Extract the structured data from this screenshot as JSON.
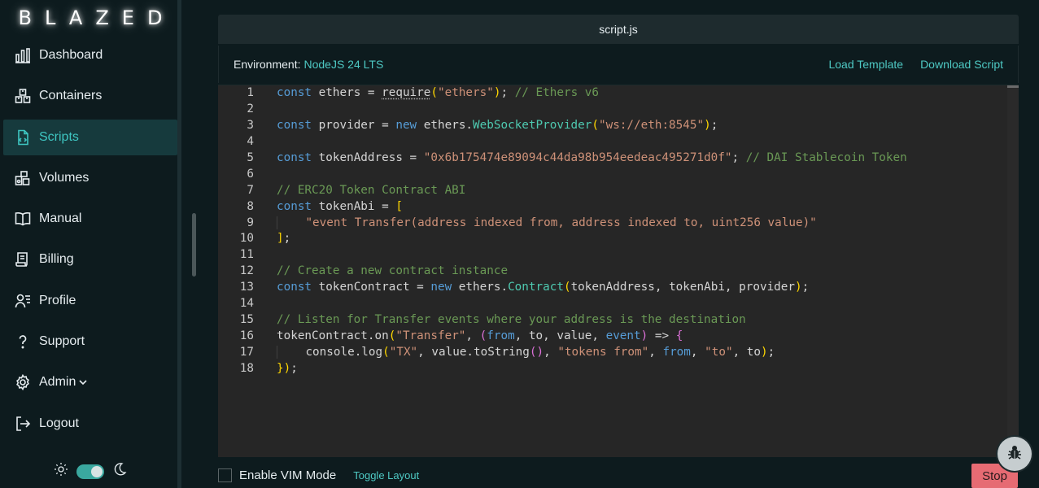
{
  "app": {
    "logo": "BLAZED"
  },
  "sidebar": {
    "items": [
      {
        "label": "Dashboard",
        "icon": "bar-chart-icon"
      },
      {
        "label": "Containers",
        "icon": "containers-icon"
      },
      {
        "label": "Scripts",
        "icon": "script-file-icon",
        "active": true
      },
      {
        "label": "Volumes",
        "icon": "volumes-icon"
      },
      {
        "label": "Manual",
        "icon": "book-icon"
      },
      {
        "label": "Billing",
        "icon": "receipt-icon"
      },
      {
        "label": "Profile",
        "icon": "user-list-icon"
      },
      {
        "label": "Support",
        "icon": "question-icon"
      },
      {
        "label": "Admin",
        "icon": "gear-icon"
      },
      {
        "label": "Logout",
        "icon": "logout-icon"
      }
    ],
    "theme": {
      "light_icon": "sun-icon",
      "dark_icon": "moon-icon",
      "dark_enabled": true
    }
  },
  "editor": {
    "tab_title": "script.js",
    "environment_label": "Environment:",
    "environment_value": "NodeJS 24 LTS",
    "load_template": "Load Template",
    "download_script": "Download Script",
    "lines": [
      "const ethers = require(\"ethers\"); // Ethers v6",
      "",
      "const provider = new ethers.WebSocketProvider(\"ws://eth:8545\");",
      "",
      "const tokenAddress = \"0x6b175474e89094c44da98b954eedeac495271d0f\"; // DAI Stablecoin Token",
      "",
      "// ERC20 Token Contract ABI",
      "const tokenAbi = [",
      "    \"event Transfer(address indexed from, address indexed to, uint256 value)\"",
      "];",
      "",
      "// Create a new contract instance",
      "const tokenContract = new ethers.Contract(tokenAddress, tokenAbi, provider);",
      "",
      "// Listen for Transfer events where your address is the destination",
      "tokenContract.on(\"Transfer\", (from, to, value, event) => {",
      "    console.log(\"TX\", value.toString(), \"tokens from\", from, \"to\", to);",
      "});"
    ]
  },
  "bottom": {
    "vim_label": "Enable VIM Mode",
    "vim_enabled": false,
    "toggle_layout": "Toggle Layout",
    "stop": "Stop"
  },
  "colors": {
    "accent": "#4ec9c4",
    "active_bg": "#163a3d",
    "stop": "#e66b73",
    "background": "#0d1b1e",
    "editor_bg": "#262626"
  }
}
